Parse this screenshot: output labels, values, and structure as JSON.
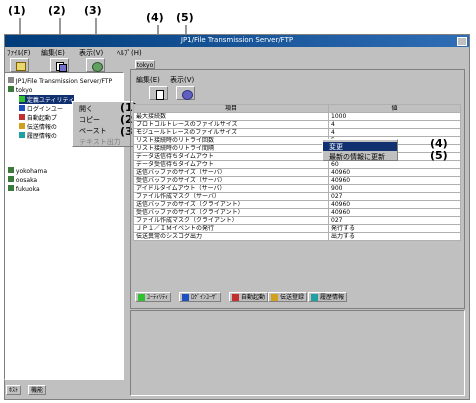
{
  "callouts": [
    "(1)",
    "(2)",
    "(3)",
    "(4)",
    "(5)",
    "(1)",
    "(2)",
    "(3)",
    "(4)",
    "(5)"
  ],
  "title": "JP1/File Transmission Server/FTP",
  "menu": [
    "ﾌｧｲﾙ(F)",
    "編集(E)",
    "表示(V)",
    "ﾍﾙﾌﾟ(H)"
  ],
  "tree": {
    "root": "JP1/File Transmission Server/FTP",
    "host": "tokyo",
    "children": [
      "定義ユティリティ",
      "ログインユー",
      "自動起動プ",
      "伝送情報の",
      "履歴情報の"
    ],
    "others": [
      "yokohama",
      "oosaka",
      "fukuoka"
    ]
  },
  "context_menu": [
    "開く",
    "コピー",
    "ペースト",
    "テキスト出力"
  ],
  "left_tabs": [
    "ﾎｽﾄ",
    "機能"
  ],
  "right_panel": {
    "tab": "tokyo",
    "menu": [
      "編集(E)",
      "表示(V)"
    ]
  },
  "table": {
    "headers": [
      "項目",
      "値"
    ],
    "rows": [
      [
        "最大接続数",
        "1000"
      ],
      [
        "プロトコルトレースのファイルサイズ",
        "4"
      ],
      [
        "モジュールトレースのファイルサイズ",
        "4"
      ],
      [
        "リスト接続時のリトライ回数",
        "5"
      ],
      [
        "リスト接続時のリトライ間隔",
        "2"
      ],
      [
        "データ送信待ちタイムアウト",
        "60"
      ],
      [
        "データ受信待ちタイムアウト",
        "60"
      ],
      [
        "送信バッファのサイズ（サーバ）",
        "40960"
      ],
      [
        "受信バッファのサイズ（サーバ）",
        "40960"
      ],
      [
        "アイドルタイムアウト（サーバ）",
        "900"
      ],
      [
        "ファイル作成マスク（サーバ）",
        "027"
      ],
      [
        "送信バッファのサイズ（クライアント）",
        "40960"
      ],
      [
        "受信バッファのサイズ（クライアント）",
        "40960"
      ],
      [
        "ファイル作成マスク（クライアント）",
        "027"
      ],
      [
        "ＪＰ１／ＩＭイベントの発行",
        "発行する"
      ],
      [
        "伝送異常のシスコグ出力",
        "出力する"
      ]
    ]
  },
  "right_context_menu": [
    "変更",
    "最新の情報に更新"
  ],
  "bottom_tabs": [
    "ﾕｰﾃｨﾘﾃｨ",
    "ﾛｸﾞｲﾝﾕｰｻﾞ",
    "自動起動",
    "伝送登録",
    "履歴情報"
  ]
}
